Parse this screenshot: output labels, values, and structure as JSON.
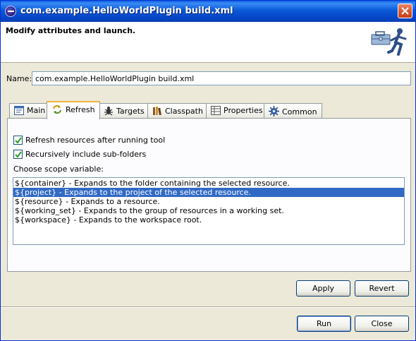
{
  "window": {
    "title": "com.example.HelloWorldPlugin build.xml"
  },
  "header": {
    "heading": "Modify attributes and launch."
  },
  "name_field": {
    "label": "Name:",
    "value": "com.example.HelloWorldPlugin build.xml"
  },
  "tabs": [
    {
      "label": "Main",
      "icon": "main-tab-icon",
      "active": false
    },
    {
      "label": "Refresh",
      "icon": "refresh-tab-icon",
      "active": true
    },
    {
      "label": "Targets",
      "icon": "targets-tab-icon",
      "active": false
    },
    {
      "label": "Classpath",
      "icon": "classpath-tab-icon",
      "active": false
    },
    {
      "label": "Properties",
      "icon": "properties-tab-icon",
      "active": false
    },
    {
      "label": "Common",
      "icon": "common-tab-icon",
      "active": false
    }
  ],
  "refresh": {
    "refresh_after_run": {
      "label": "Refresh resources after running tool",
      "checked": true
    },
    "recursive": {
      "label": "Recursively include sub-folders",
      "checked": true
    },
    "scope_label": "Choose scope variable:",
    "scope_items": [
      "${container} - Expands to the folder containing the selected resource.",
      "${project} - Expands to the project of the selected resource.",
      "${resource} - Expands to a resource.",
      "${working_set} - Expands to the group of resources in a working set.",
      "${workspace} - Expands to the workspace root."
    ],
    "selected_index": 1
  },
  "buttons": {
    "apply": "Apply",
    "revert": "Revert",
    "run": "Run",
    "close": "Close"
  },
  "colors": {
    "titlebar": "#0546c8",
    "selection": "#316ac5",
    "active_tab_accent": "#f4b43b"
  }
}
